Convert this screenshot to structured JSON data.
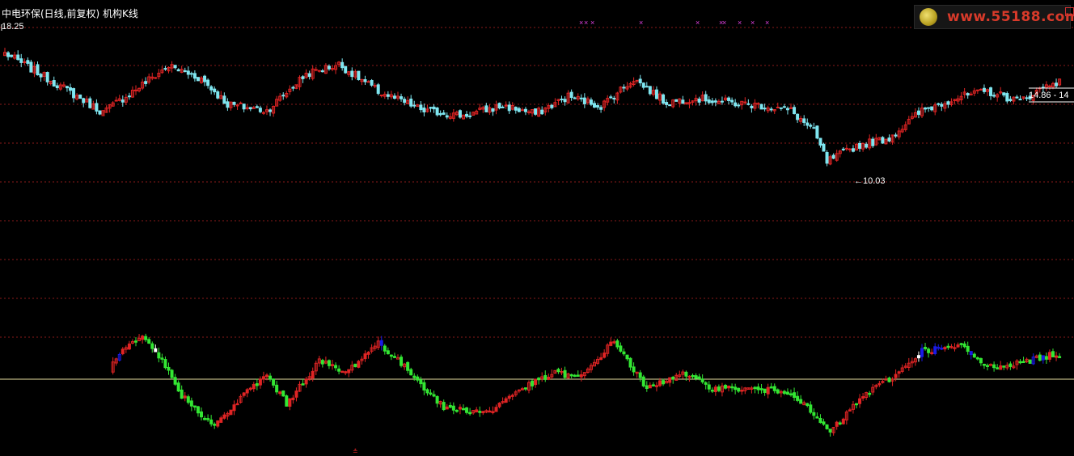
{
  "header": {
    "title": "中电环保(日线,前复权) 机构K线",
    "high_label": "18.25",
    "low_label": "←10.03",
    "range_label": "14.86 - 14",
    "logo_text": "www.55188.com"
  },
  "colors": {
    "background": "#000000",
    "grid": "#8a1a1a",
    "price_up": "#e02424",
    "price_down": "#7fe6f0",
    "ind_up": "#e02424",
    "ind_down": "#33e633",
    "ind_blue": "#1a1ae6",
    "ind_white": "#ffffff",
    "zero_line": "#e8e0a0",
    "marker": "#e040e0"
  },
  "chart_data": [
    {
      "type": "candlestick",
      "title": "中电环保(日线,前复权) 机构K线",
      "ylim": [
        9.6,
        18.6
      ],
      "annotations": {
        "high": 18.25,
        "low": 10.03
      },
      "key_closes": [
        {
          "index": 0,
          "value": 17.2
        },
        {
          "index": 14,
          "value": 15.5
        },
        {
          "index": 30,
          "value": 13.5
        },
        {
          "index": 50,
          "value": 16.4
        },
        {
          "index": 60,
          "value": 15.6
        },
        {
          "index": 68,
          "value": 14.0
        },
        {
          "index": 80,
          "value": 13.6
        },
        {
          "index": 92,
          "value": 15.9
        },
        {
          "index": 102,
          "value": 16.5
        },
        {
          "index": 114,
          "value": 14.8
        },
        {
          "index": 128,
          "value": 13.6
        },
        {
          "index": 140,
          "value": 13.3
        },
        {
          "index": 152,
          "value": 13.9
        },
        {
          "index": 162,
          "value": 13.4
        },
        {
          "index": 172,
          "value": 14.5
        },
        {
          "index": 182,
          "value": 13.9
        },
        {
          "index": 192,
          "value": 15.6
        },
        {
          "index": 202,
          "value": 14.1
        },
        {
          "index": 210,
          "value": 14.4
        },
        {
          "index": 222,
          "value": 14.1
        },
        {
          "index": 232,
          "value": 13.9
        },
        {
          "index": 240,
          "value": 13.6
        },
        {
          "index": 247,
          "value": 12.3
        },
        {
          "index": 251,
          "value": 10.4
        },
        {
          "index": 260,
          "value": 11.4
        },
        {
          "index": 270,
          "value": 11.9
        },
        {
          "index": 280,
          "value": 13.6
        },
        {
          "index": 290,
          "value": 14.4
        },
        {
          "index": 300,
          "value": 14.8
        },
        {
          "index": 310,
          "value": 14.2
        },
        {
          "index": 320,
          "value": 15.4
        }
      ]
    },
    {
      "type": "candlestick",
      "title": "",
      "ylim": [
        -3,
        3.2
      ],
      "zero_line": 0,
      "key_closes": [
        {
          "index": 30,
          "value": 0.0
        },
        {
          "index": 36,
          "value": 1.4
        },
        {
          "index": 42,
          "value": 2.0
        },
        {
          "index": 48,
          "value": 0.9
        },
        {
          "index": 54,
          "value": -0.8
        },
        {
          "index": 64,
          "value": -2.3
        },
        {
          "index": 74,
          "value": -0.6
        },
        {
          "index": 80,
          "value": 0.2
        },
        {
          "index": 86,
          "value": -1.2
        },
        {
          "index": 96,
          "value": 0.9
        },
        {
          "index": 104,
          "value": 0.3
        },
        {
          "index": 114,
          "value": 1.8
        },
        {
          "index": 124,
          "value": 0.3
        },
        {
          "index": 134,
          "value": -1.4
        },
        {
          "index": 148,
          "value": -1.6
        },
        {
          "index": 156,
          "value": -0.6
        },
        {
          "index": 168,
          "value": 0.3
        },
        {
          "index": 176,
          "value": 0.1
        },
        {
          "index": 186,
          "value": 1.9
        },
        {
          "index": 196,
          "value": -0.5
        },
        {
          "index": 206,
          "value": 0.3
        },
        {
          "index": 216,
          "value": -0.4
        },
        {
          "index": 228,
          "value": -0.5
        },
        {
          "index": 240,
          "value": -0.6
        },
        {
          "index": 252,
          "value": -2.6
        },
        {
          "index": 262,
          "value": -0.8
        },
        {
          "index": 272,
          "value": 0.2
        },
        {
          "index": 280,
          "value": 1.4
        },
        {
          "index": 292,
          "value": 1.6
        },
        {
          "index": 300,
          "value": 0.6
        },
        {
          "index": 310,
          "value": 0.8
        },
        {
          "index": 320,
          "value": 1.2
        }
      ]
    }
  ]
}
